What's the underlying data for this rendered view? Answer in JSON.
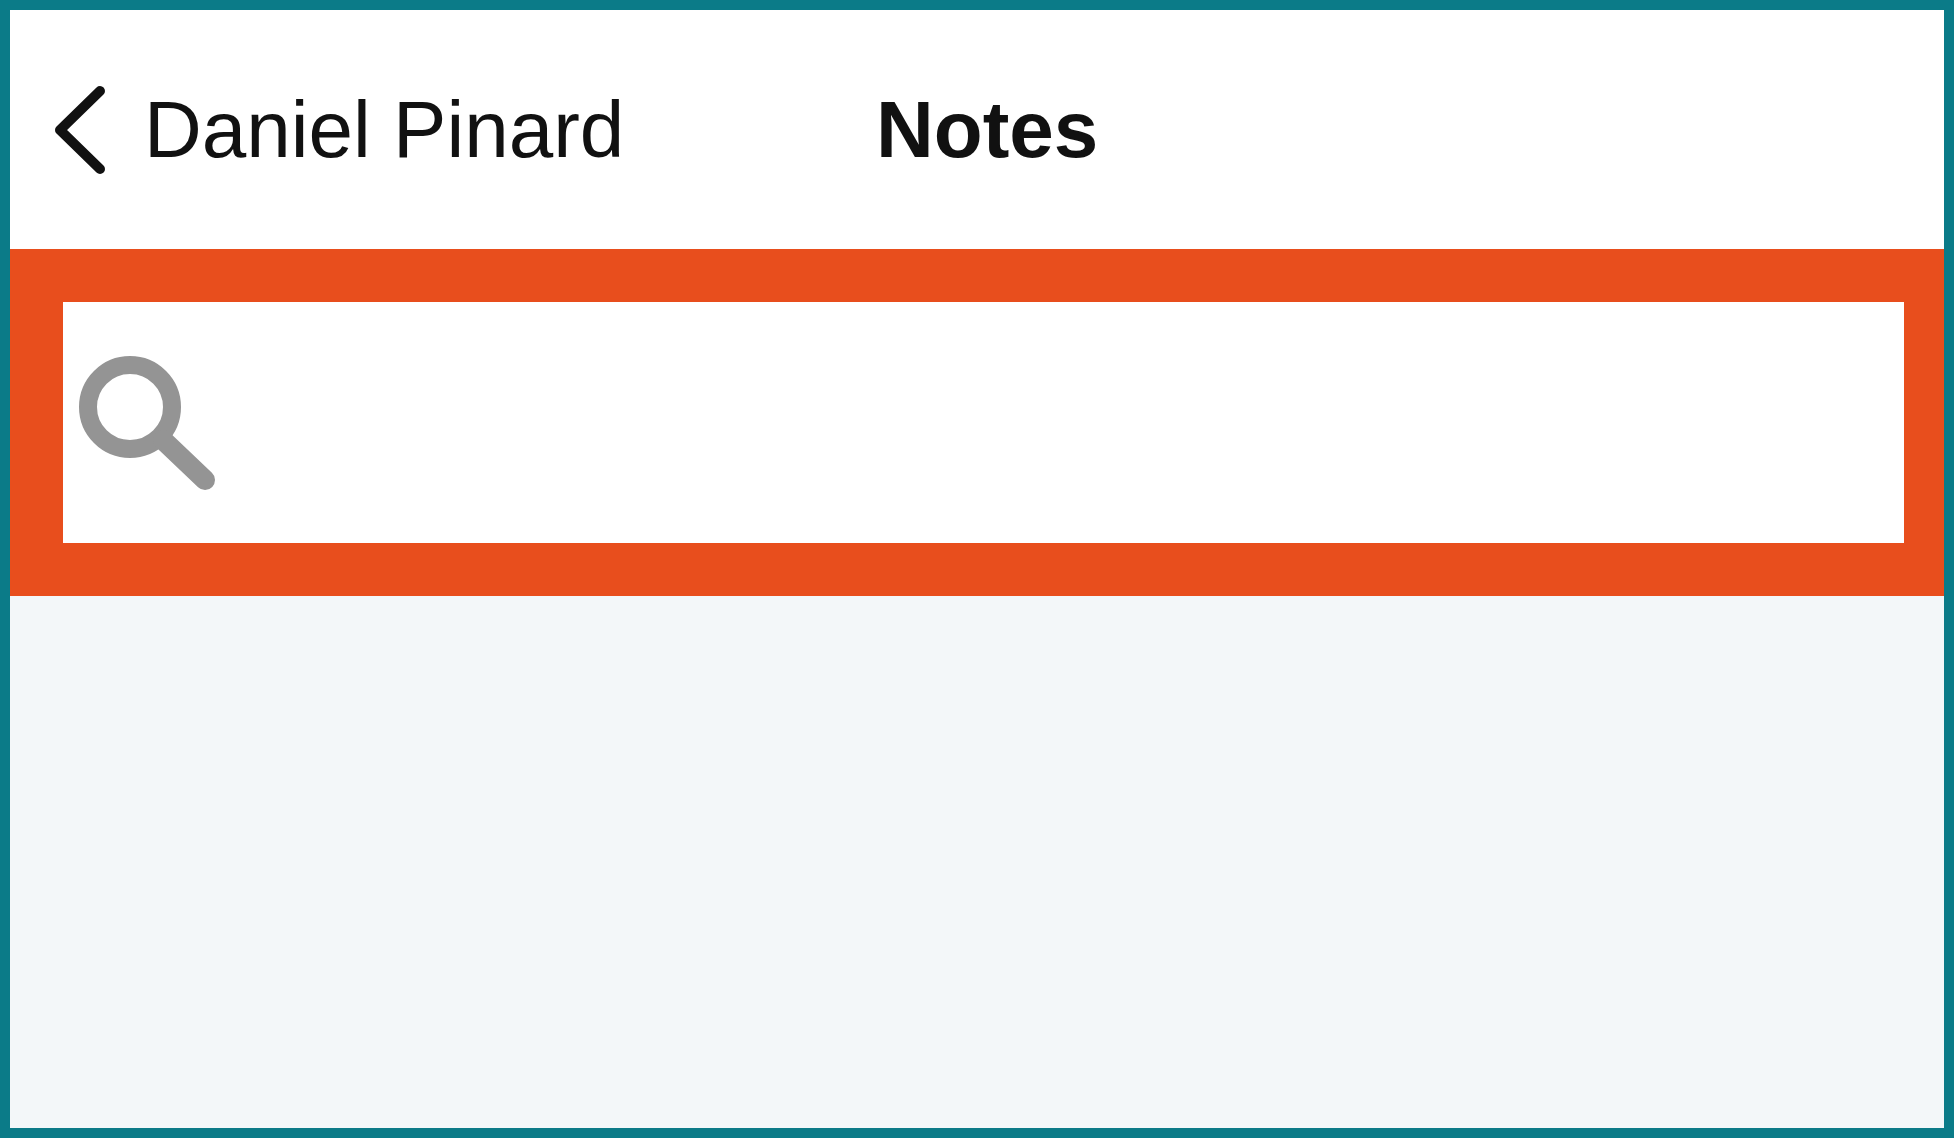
{
  "nav": {
    "back_label": "Daniel Pinard",
    "title": "Notes"
  },
  "search": {
    "highlighted": true
  }
}
